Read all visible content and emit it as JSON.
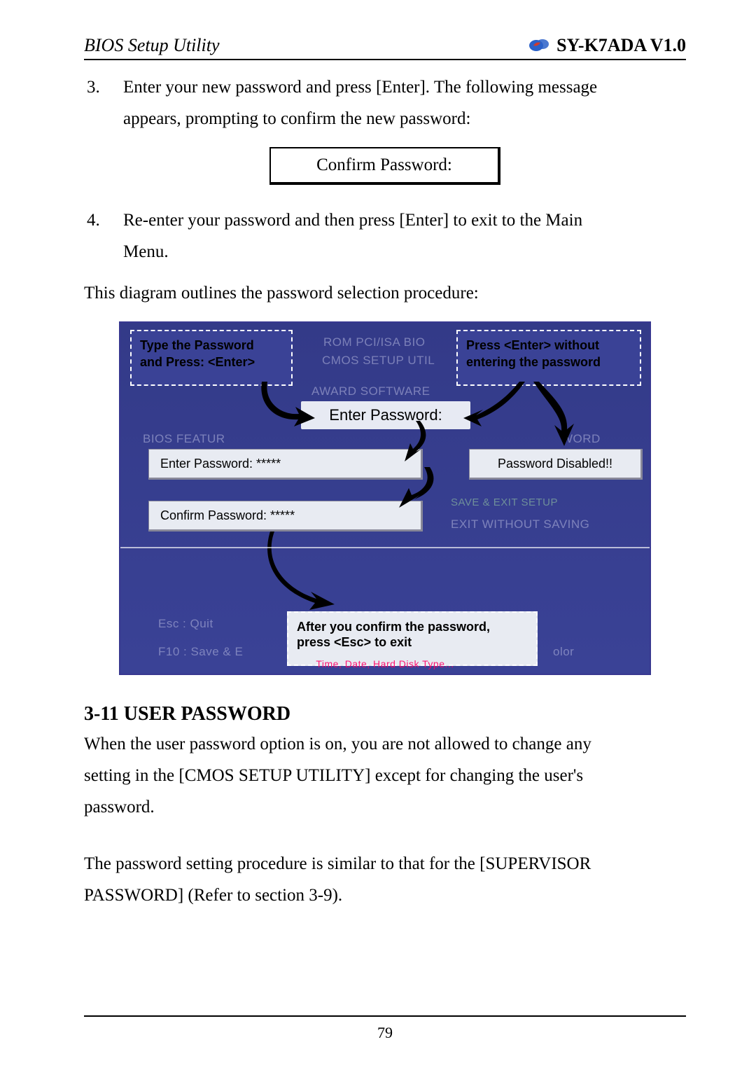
{
  "header": {
    "left": "BIOS Setup Utility",
    "right": "SY-K7ADA V1.0"
  },
  "item3": {
    "num": "3.",
    "text_a": "Enter your new password and press [Enter]. The following message",
    "text_b": "appears, prompting to confirm the new password:"
  },
  "confirm_box": "Confirm Password:",
  "item4": {
    "num": "4.",
    "text_a": "Re-enter your password and then press [Enter] to exit to the Main",
    "text_b": "Menu."
  },
  "outline": "This diagram outlines the password selection procedure:",
  "diagram": {
    "hint_tl_line1": "Type the Password",
    "hint_tl_line2": "and Press: <Enter>",
    "hint_tr_line1": "Press <Enter> without",
    "hint_tr_line2": "entering the password",
    "enter_panel": "Enter Password:",
    "enter_field": "Enter Password: *****",
    "confirm_field": "Confirm Password: *****",
    "disabled_field": "Password Disabled!!",
    "hint_bm_line1": "After you confirm the password,",
    "hint_bm_line2": "press <Esc> to exit",
    "wm": {
      "rom": "ROM PCI/ISA BIO",
      "cmos": "CMOS SETUP UTIL",
      "award": "AWARD SOFTWARE",
      "bios_feat": "BIOS FEATUR",
      "word": "WORD",
      "save_exit": "SAVE & EXIT SETUP",
      "exit_wo": "EXIT WITHOUT SAVING",
      "esc": "Esc  : Quit",
      "f10": "F10  : Save & E",
      "olor": "olor",
      "footer": "Time, Date, Hard Disk Type..."
    }
  },
  "section": {
    "title": "3-11  USER PASSWORD",
    "p1a": "When the user password option is on, you are not allowed to change any",
    "p1b": "setting in the [CMOS SETUP UTILITY] except for changing the user's",
    "p1c": "password.",
    "p2a": "The password setting procedure is similar to that for the [SUPERVISOR",
    "p2b": "PASSWORD] (Refer to section 3-9)."
  },
  "page_number": "79"
}
